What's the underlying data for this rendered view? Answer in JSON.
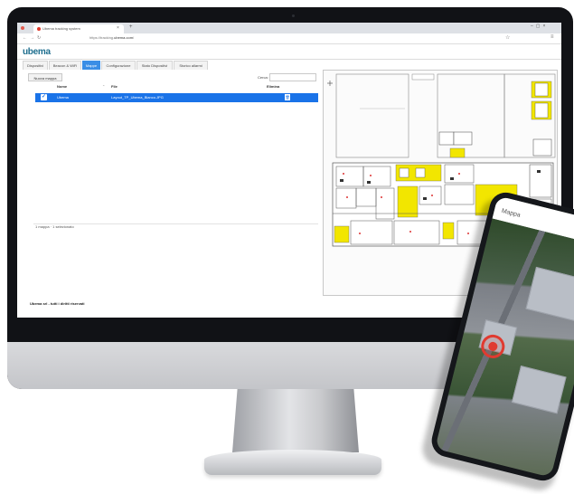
{
  "browser": {
    "tab_title": "Ubema tracking system",
    "url_prefix": "https://tracking.",
    "url_domain": "ubema.com",
    "url_path": "/",
    "new_tab_symbol": "+",
    "close_symbol": "×"
  },
  "app": {
    "logo": "ubema",
    "nav_tabs": [
      {
        "label": "Dispositivi",
        "active": false
      },
      {
        "label": "Beacon & WiFi",
        "active": false
      },
      {
        "label": "Mappe",
        "active": true
      },
      {
        "label": "Configurazione",
        "active": false
      },
      {
        "label": "Stato Dispositivi",
        "active": false
      },
      {
        "label": "Storico allarmi",
        "active": false
      }
    ],
    "new_map_button": "Nuova mappa",
    "search_label": "Cerca:",
    "search_value": "",
    "table": {
      "headers": {
        "name": "Nome",
        "file": "File",
        "delete": "Elimina"
      },
      "rows": [
        {
          "name": "Ubema",
          "file": "Layout_TP_Ubema_Bianco.JPG",
          "selected": true
        }
      ]
    },
    "footer_info": "1 mappa · 1 selezionato",
    "copyright": "Ubema srl - tutti i diritti riservati"
  },
  "phone": {
    "title": "Mappa"
  },
  "colors": {
    "accent": "#1a73e8",
    "brand": "#1e6e8e",
    "plan_highlight": "#f2e600",
    "pin": "#e03a30"
  }
}
